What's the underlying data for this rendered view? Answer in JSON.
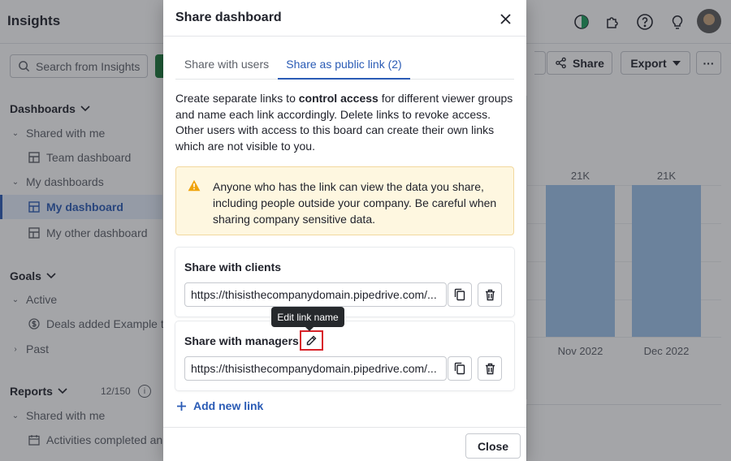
{
  "app": {
    "title": "Insights",
    "search_placeholder": "Search from Insights"
  },
  "sidebar": {
    "dashboards_label": "Dashboards",
    "shared_with_me": "Shared with me",
    "team_dashboard": "Team dashboard",
    "my_dashboards": "My dashboards",
    "my_dashboard": "My dashboard",
    "my_other_dashboard": "My other dashboard",
    "goals_label": "Goals",
    "active": "Active",
    "deals_added": "Deals added Example t...",
    "past": "Past",
    "reports_label": "Reports",
    "reports_count": "12/150",
    "reports_shared": "Shared with me",
    "activities_completed": "Activities completed an"
  },
  "toolbar": {
    "share_label": "Share",
    "export_label": "Export",
    "more_label": "···"
  },
  "chart_data": {
    "type": "bar",
    "categories": [
      "Nov 2022",
      "Dec 2022"
    ],
    "values": [
      21000,
      21000
    ],
    "data_labels": [
      "21K",
      "21K"
    ]
  },
  "modal": {
    "title": "Share dashboard",
    "tabs": [
      {
        "label": "Share with users"
      },
      {
        "label": "Share as public link (2)"
      }
    ],
    "desc_part1": "Create separate links to ",
    "desc_bold": "control access",
    "desc_part2": " for different viewer groups and name each link accordingly. Delete links to revoke access. Other users with access to this board can create their own links which are not visible to you.",
    "warning": "Anyone who has the link can view the data you share, including people outside your company. Be careful when sharing company sensitive data.",
    "links": [
      {
        "name": "Share with clients",
        "url": "https://thisisthecompanydomain.pipedrive.com/..."
      },
      {
        "name": "Share with managers",
        "url": "https://thisisthecompanydomain.pipedrive.com/..."
      }
    ],
    "tooltip": "Edit link name",
    "add_link": "Add new link",
    "close_label": "Close"
  },
  "colors": {
    "accent": "#2a5bb5",
    "warning_bg": "#fef7e0",
    "warning_icon": "#f0a30a",
    "highlight": "#d8232a",
    "bar": "#9dc3ea"
  }
}
